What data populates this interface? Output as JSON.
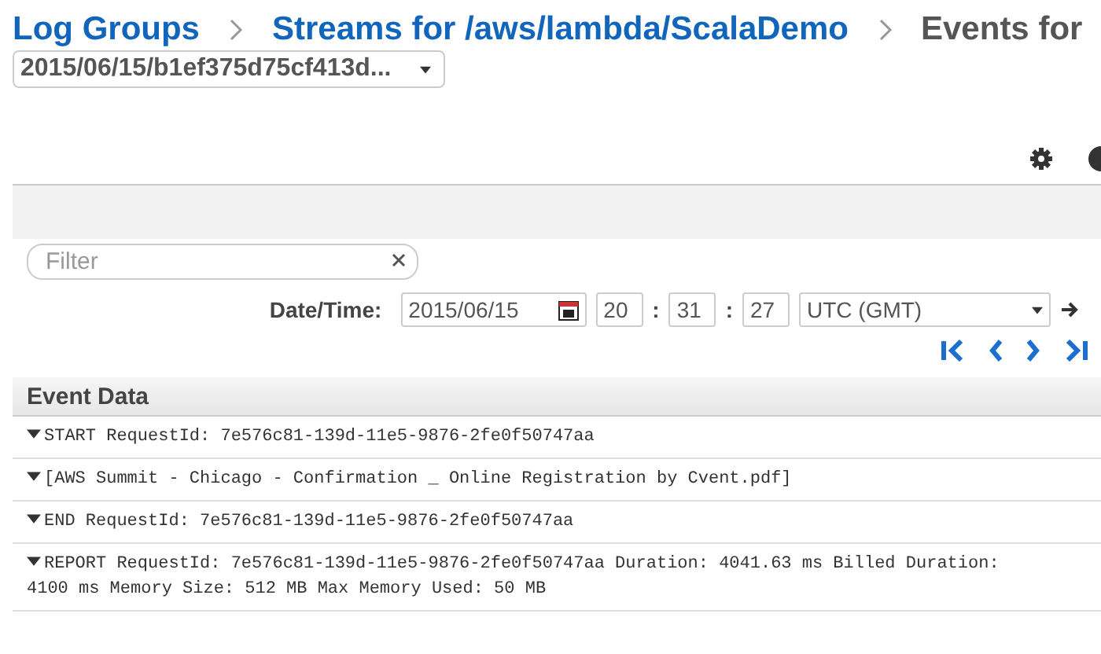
{
  "breadcrumb": [
    {
      "label": "Log Groups",
      "kind": "link"
    },
    {
      "label": "Streams for /aws/lambda/ScalaDemo",
      "kind": "link"
    },
    {
      "label": "Events for",
      "kind": "current"
    }
  ],
  "stream_select": {
    "value": "2015/06/15/b1ef375d75cf413d..."
  },
  "filter": {
    "placeholder": "Filter"
  },
  "datetime": {
    "label": "Date/Time:",
    "date": "2015/06/15",
    "hour": "20",
    "separators": [
      ":",
      ":"
    ],
    "minute": "31",
    "second": "27",
    "timezone": "UTC (GMT)"
  },
  "table": {
    "column": "Event Data",
    "rows": [
      {
        "text": "START RequestId: 7e576c81-139d-11e5-9876-2fe0f50747aa"
      },
      {
        "text": "[AWS Summit - Chicago - Confirmation _ Online Registration by Cvent.pdf]"
      },
      {
        "text": "END RequestId: 7e576c81-139d-11e5-9876-2fe0f50747aa"
      },
      {
        "text": "REPORT RequestId: 7e576c81-139d-11e5-9876-2fe0f50747aa Duration: 4041.63 ms Billed Duration: 4100 ms Memory Size: 512 MB Max Memory Used: 50 MB"
      }
    ]
  }
}
